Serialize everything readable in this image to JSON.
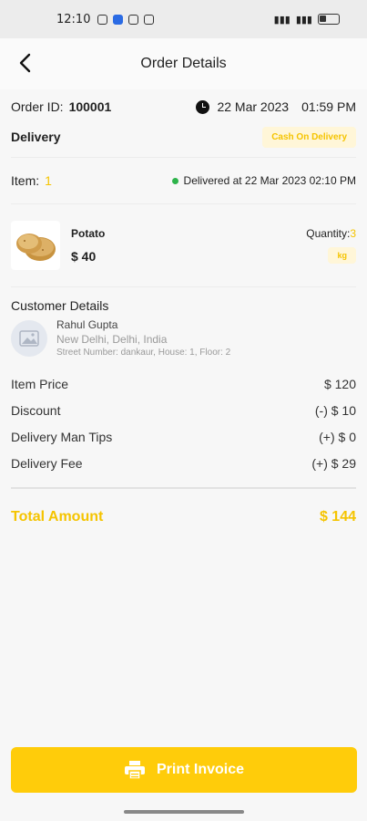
{
  "status_bar": {
    "time": "12:10"
  },
  "appbar": {
    "title": "Order Details"
  },
  "order": {
    "id_label": "Order ID:",
    "id_value": "100001",
    "date": "22 Mar 2023",
    "time": "01:59 PM",
    "type": "Delivery",
    "payment_badge": "Cash On Delivery"
  },
  "items_summary": {
    "label": "Item:",
    "count": "1",
    "delivered_text": "Delivered at 22 Mar 2023  02:10 PM",
    "status_color": "#2db34a"
  },
  "product": {
    "name": "Potato",
    "price": "$ 40",
    "quantity_label": "Quantity:",
    "quantity_value": "3",
    "unit": "kg"
  },
  "customer": {
    "section_title": "Customer Details",
    "name": "Rahul Gupta",
    "address": "New Delhi, Delhi, India",
    "street": "Street Number: dankaur, House: 1, Floor: 2"
  },
  "pricing": [
    {
      "label": "Item Price",
      "value": "$ 120"
    },
    {
      "label": "Discount",
      "value": "(-) $ 10"
    },
    {
      "label": "Delivery Man Tips",
      "value": "(+) $ 0"
    },
    {
      "label": "Delivery Fee",
      "value": "(+) $ 29"
    }
  ],
  "total": {
    "label": "Total Amount",
    "value": "$ 144"
  },
  "print_button": {
    "label": "Print Invoice",
    "icon": "printer-icon"
  },
  "colors": {
    "accent": "#ffcc0a",
    "accent_text": "#f5c400"
  }
}
